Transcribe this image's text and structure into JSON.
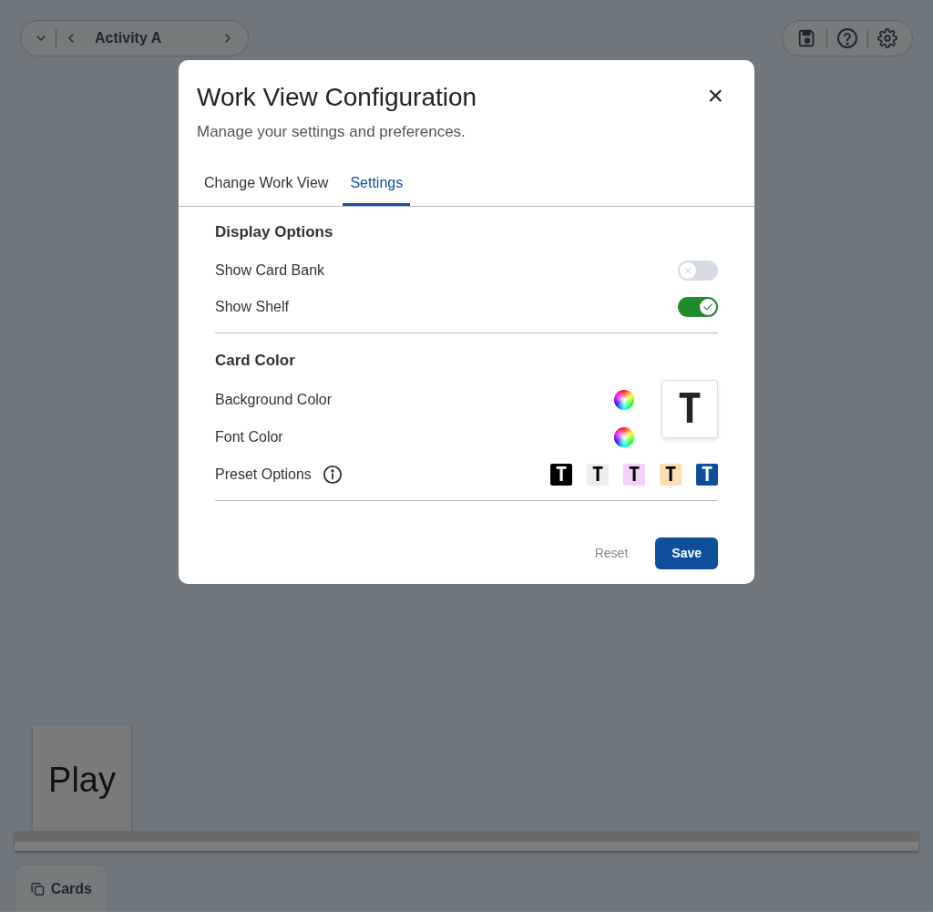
{
  "toolbar": {
    "activity": "Activity A"
  },
  "dialog": {
    "title": "Work View Configuration",
    "subtitle": "Manage your settings and preferences.",
    "close": "×",
    "tabs": [
      {
        "label": "Change Work View",
        "selected": false
      },
      {
        "label": "Settings",
        "selected": true
      }
    ],
    "display_options": {
      "heading": "Display Options",
      "toggles": [
        {
          "label": "Show Card Bank",
          "on": false
        },
        {
          "label": "Show Shelf",
          "on": true
        }
      ]
    },
    "card_color": {
      "heading": "Card Color",
      "background_label": "Background Color",
      "font_label": "Font Color",
      "preset_label": "Preset Options",
      "preview": {
        "glyph": "T"
      },
      "presets": [
        {
          "glyph": "T",
          "color": "#000000",
          "kind": "inverse"
        },
        {
          "glyph": "T",
          "color": "#eeeeee",
          "kind": "plain"
        },
        {
          "glyph": "T",
          "color": "#f3d2f7",
          "kind": "plain"
        },
        {
          "glyph": "T",
          "color": "#f9dfb3",
          "kind": "plain"
        },
        {
          "glyph": "T",
          "color": "#0d4f9a",
          "kind": "inverse"
        }
      ]
    },
    "buttons": {
      "reset": "Reset",
      "save": "Save"
    }
  },
  "shelf": {
    "card": "Play"
  },
  "cards_button": "Cards"
}
